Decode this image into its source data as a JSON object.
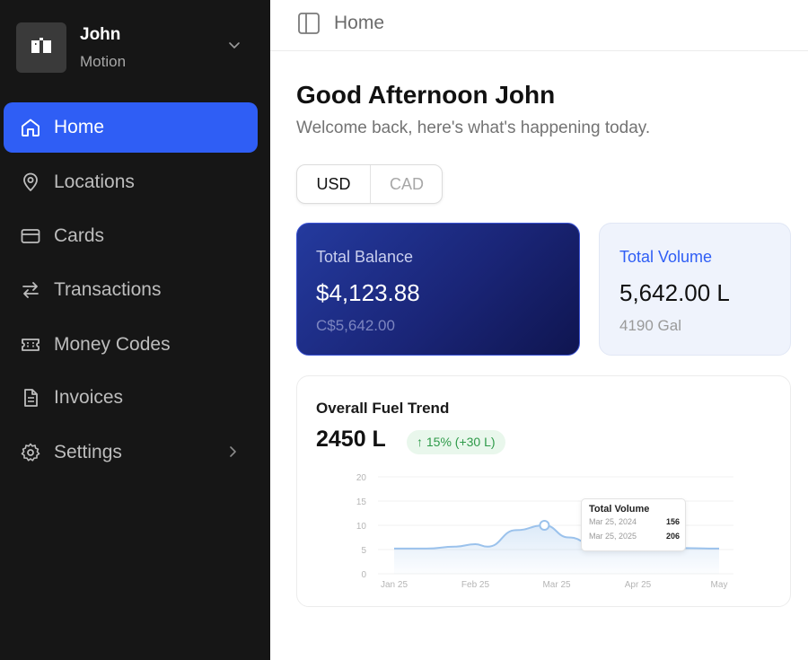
{
  "account": {
    "name": "John",
    "org": "Motion"
  },
  "nav": [
    {
      "label": "Home",
      "icon": "home-icon",
      "active": true
    },
    {
      "label": "Locations",
      "icon": "map-pin-icon"
    },
    {
      "label": "Cards",
      "icon": "credit-card-icon"
    },
    {
      "label": "Transactions",
      "icon": "arrows-swap-icon"
    },
    {
      "label": "Money Codes",
      "icon": "ticket-icon"
    },
    {
      "label": "Invoices",
      "icon": "document-icon"
    },
    {
      "label": "Settings",
      "icon": "gear-icon",
      "has_submenu": true
    }
  ],
  "topbar": {
    "breadcrumb": "Home"
  },
  "greeting": {
    "title": "Good Afternoon John",
    "subtitle": "Welcome back, here's what's happening today."
  },
  "currency": {
    "options": [
      "USD",
      "CAD"
    ],
    "selected": "USD"
  },
  "balance": {
    "title": "Total Balance",
    "value": "$4,123.88",
    "secondary": "C$5,642.00"
  },
  "volume": {
    "title": "Total Volume",
    "value": "5,642.00 L",
    "secondary": "4190 Gal"
  },
  "trend": {
    "title": "Overall Fuel Trend",
    "value": "2450 L",
    "change": "15% (+30 L)"
  },
  "colors": {
    "accent": "#2f5ef5",
    "sidebar": "#161616",
    "positive": "#2e9a49",
    "line": "#9bc2ec"
  },
  "chart_data": {
    "type": "area",
    "x_ticks": [
      "Jan 25",
      "Feb 25",
      "Mar 25",
      "Apr 25",
      "May"
    ],
    "y_ticks": [
      "0",
      "5",
      "10",
      "15",
      "20"
    ],
    "ylim": [
      0,
      20
    ],
    "grid": true,
    "points": [
      {
        "x": 0,
        "y": 5.2
      },
      {
        "x": 0.4,
        "y": 5.2
      },
      {
        "x": 0.75,
        "y": 5.6
      },
      {
        "x": 1.0,
        "y": 6.1
      },
      {
        "x": 1.15,
        "y": 5.6
      },
      {
        "x": 1.5,
        "y": 9.0
      },
      {
        "x": 1.85,
        "y": 10.0
      },
      {
        "x": 2.15,
        "y": 7.5
      },
      {
        "x": 2.5,
        "y": 5.5
      },
      {
        "x": 3.0,
        "y": 5.4
      },
      {
        "x": 3.5,
        "y": 5.3
      },
      {
        "x": 4.0,
        "y": 5.2
      }
    ],
    "highlight_index": 6,
    "tooltip": {
      "title": "Total Volume",
      "rows": [
        {
          "label": "Mar 25, 2024",
          "value": "156"
        },
        {
          "label": "Mar 25, 2025",
          "value": "206"
        }
      ]
    }
  }
}
